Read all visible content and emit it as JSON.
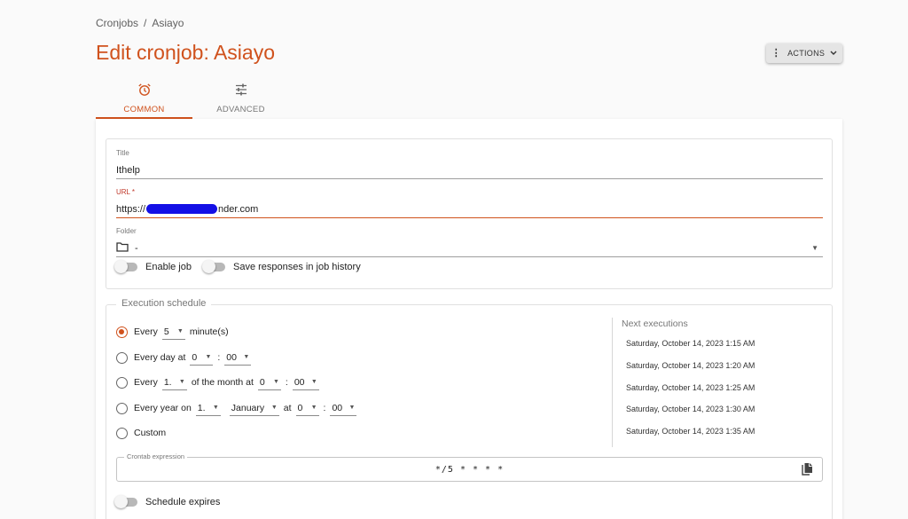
{
  "breadcrumb": {
    "root": "Cronjobs",
    "separator": "/",
    "current": "Asiayo"
  },
  "page_title": "Edit cronjob: Asiayo",
  "actions_label": "ACTIONS",
  "tabs": [
    {
      "label": "COMMON",
      "icon": "alarm-clock-icon",
      "active": true
    },
    {
      "label": "ADVANCED",
      "icon": "sliders-icon",
      "active": false
    }
  ],
  "form": {
    "title_label": "Title",
    "title_value": "Ithelp",
    "url_label": "URL *",
    "url_prefix": "https://",
    "url_suffix": "nder.com",
    "folder_label": "Folder",
    "folder_value": "-",
    "enable_job_label": "Enable job",
    "save_responses_label": "Save responses in job history"
  },
  "schedule": {
    "legend": "Execution schedule",
    "every_label": "Every",
    "every_value": "5",
    "every_unit": "minute(s)",
    "daily_label": "Every day at",
    "daily_hour": "0",
    "daily_min": "00",
    "monthly_label": "Every",
    "monthly_day": "1.",
    "monthly_mid": "of the month at",
    "monthly_hour": "0",
    "monthly_min": "00",
    "yearly_label": "Every year on",
    "yearly_day": "1.",
    "yearly_month": "January",
    "yearly_at": "at",
    "yearly_hour": "0",
    "yearly_min": "00",
    "custom_label": "Custom",
    "colon": ":",
    "next_title": "Next executions",
    "next_executions": [
      "Saturday, October 14, 2023 1:15 AM",
      "Saturday, October 14, 2023 1:20 AM",
      "Saturday, October 14, 2023 1:25 AM",
      "Saturday, October 14, 2023 1:30 AM",
      "Saturday, October 14, 2023 1:35 AM"
    ],
    "crontab_label": "Crontab expression",
    "crontab_value": "*/5 * * * *",
    "expires_label": "Schedule expires"
  },
  "colors": {
    "accent": "#d0521d",
    "redaction": "#1410e6"
  }
}
